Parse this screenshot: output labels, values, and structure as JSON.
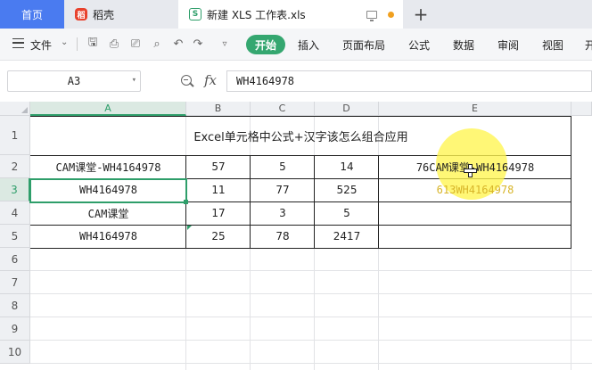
{
  "tabs": {
    "home": "首页",
    "wps": "稻壳",
    "doc": "新建 XLS 工作表.xls"
  },
  "ribbon": {
    "file": "文件",
    "start": "开始",
    "menu": [
      "插入",
      "页面布局",
      "公式",
      "数据",
      "审阅",
      "视图",
      "开"
    ]
  },
  "formula_bar": {
    "name_box": "A3",
    "fx": "fx",
    "content": "WH4164978"
  },
  "grid": {
    "columns": [
      "A",
      "B",
      "C",
      "D",
      "E"
    ],
    "rows": [
      "1",
      "2",
      "3",
      "4",
      "5",
      "6",
      "7",
      "8",
      "9",
      "10"
    ],
    "title": "Excel单元格中公式+汉字该怎么组合应用",
    "cells": {
      "A2": "CAM课堂-WH4164978",
      "B2": "57",
      "C2": "5",
      "D2": "14",
      "E2": "76CAM课堂-WH4164978",
      "A3": "WH4164978",
      "B3": "11",
      "C3": "77",
      "D3": "525",
      "E3": "613WH4164978",
      "A4": "CAM课堂",
      "B4": "17",
      "C4": "3",
      "D4": "5",
      "A5": "WH4164978",
      "B5": "25",
      "C5": "78",
      "D5": "2417"
    }
  },
  "colors": {
    "accent": "#2e9e6a",
    "home_tab": "#4a7bf0",
    "highlight": "#fff550"
  }
}
